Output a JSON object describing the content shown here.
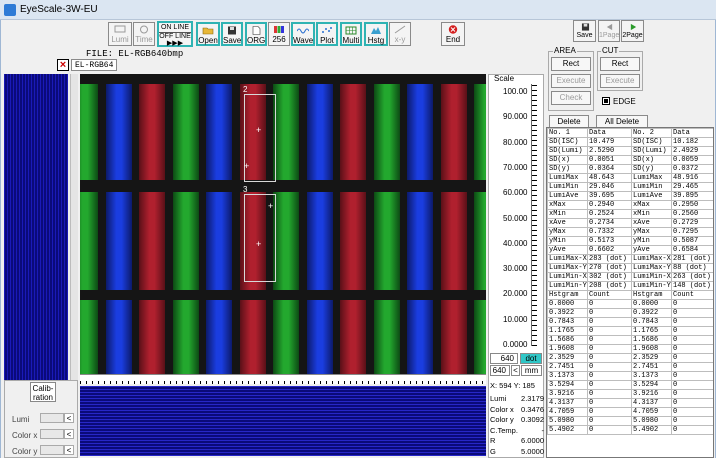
{
  "window": {
    "title": "EyeScale-3W-EU"
  },
  "toolbar": {
    "lumi": "Lumi",
    "time": "Time",
    "online": "ON LINE",
    "offline": "OFF LINE",
    "open": "Open",
    "save": "Save",
    "org": "ORG",
    "c256": "256",
    "wave": "Wave",
    "plot": "Plot",
    "multi": "Multi",
    "hstg": "Hstg",
    "xy": "x-y",
    "end": "End"
  },
  "nav": {
    "save": "Save",
    "page1": "1Page",
    "page2": "2Page"
  },
  "file": {
    "label": "FILE:",
    "name": "EL-RGB640bmp",
    "tab": "EL-RGB64"
  },
  "roi": [
    {
      "num": "2"
    },
    {
      "num": "3"
    }
  ],
  "calibration": {
    "title_1": "Calib-",
    "title_2": "ration",
    "labels": [
      "Lumi",
      "Color x",
      "Color y"
    ]
  },
  "scale": {
    "title": "Scale",
    "labels": [
      "100.00",
      "90.000",
      "80.000",
      "70.000",
      "60.000",
      "50.000",
      "40.000",
      "30.000",
      "20.000",
      "10.000",
      "0.0000"
    ],
    "width": "640",
    "height": "640",
    "unit_dot": "dot",
    "unit_mm": "mm",
    "arrow": "<"
  },
  "readout": {
    "xy": "X:  594 Y:  185",
    "rows": [
      {
        "k": "Lumi",
        "v": "2.3179"
      },
      {
        "k": "Color x",
        "v": "0.3476"
      },
      {
        "k": "Color y",
        "v": "0.3092"
      },
      {
        "k": "C.Temp.",
        "v": "-"
      },
      {
        "k": "R",
        "v": "6.0000"
      },
      {
        "k": "G",
        "v": "5.0000"
      }
    ]
  },
  "area": {
    "title": "AREA",
    "rect": "Rect",
    "execute": "Execute",
    "check": "Check"
  },
  "cut": {
    "title": "CUT",
    "rect": "Rect",
    "execute": "Execute"
  },
  "edge": "EDGE",
  "table_buttons": {
    "delete": "Delete",
    "all_delete": "All Delete"
  },
  "table": {
    "rows": [
      [
        "No. 1",
        "Data",
        "No. 2",
        "Data"
      ],
      [
        "SD(ISC)",
        "10.479",
        "SD(ISC)",
        "10.182"
      ],
      [
        "SD(Lumi)",
        "2.5290",
        "SD(Lumi)",
        "2.4929"
      ],
      [
        "SD(x)",
        "0.0051",
        "SD(x)",
        "0.0059"
      ],
      [
        "SD(y)",
        "0.0364",
        "SD(y)",
        "0.0372"
      ],
      [
        "LumiMax",
        "48.643",
        "LumiMax",
        "48.916"
      ],
      [
        "LumiMin",
        "29.046",
        "LumiMin",
        "29.465"
      ],
      [
        "LumiAve",
        "39.695",
        "LumiAve",
        "39.895"
      ],
      [
        "xMax",
        "0.2940",
        "xMax",
        "0.2950"
      ],
      [
        "xMin",
        "0.2524",
        "xMin",
        "0.2560"
      ],
      [
        "xAve",
        "0.2734",
        "xAve",
        "0.2729"
      ],
      [
        "yMax",
        "0.7332",
        "yMax",
        "0.7295"
      ],
      [
        "yMin",
        "0.5173",
        "yMin",
        "0.5087"
      ],
      [
        "yAve",
        "0.6602",
        "yAve",
        "0.6584"
      ],
      [
        "LumiMax-X",
        "283 (dot)",
        "LumiMax-X",
        "281 (dot)"
      ],
      [
        "LumiMax-Y",
        "270 (dot)",
        "LumiMax-Y",
        "88 (dot)"
      ],
      [
        "LumiMin-X",
        "302 (dot)",
        "LumiMin-X",
        "263 (dot)"
      ],
      [
        "LumiMin-Y",
        "208 (dot)",
        "LumiMin-Y",
        "148 (dot)"
      ],
      [
        "Hstgram",
        "Count",
        "Hstgram",
        "Count"
      ],
      [
        "0.0000",
        "0",
        "0.0000",
        "0"
      ],
      [
        "0.3922",
        "0",
        "0.3922",
        "0"
      ],
      [
        "0.7843",
        "0",
        "0.7843",
        "0"
      ],
      [
        "1.1765",
        "0",
        "1.1765",
        "0"
      ],
      [
        "1.5686",
        "0",
        "1.5686",
        "0"
      ],
      [
        "1.9608",
        "0",
        "1.9608",
        "0"
      ],
      [
        "2.3529",
        "0",
        "2.3529",
        "0"
      ],
      [
        "2.7451",
        "0",
        "2.7451",
        "0"
      ],
      [
        "3.1373",
        "0",
        "3.1373",
        "0"
      ],
      [
        "3.5294",
        "0",
        "3.5294",
        "0"
      ],
      [
        "3.9216",
        "0",
        "3.9216",
        "0"
      ],
      [
        "4.3137",
        "0",
        "4.3137",
        "0"
      ],
      [
        "4.7059",
        "0",
        "4.7059",
        "0"
      ],
      [
        "5.0980",
        "0",
        "5.0980",
        "0"
      ],
      [
        "5.4902",
        "0",
        "5.4902",
        "0"
      ]
    ]
  },
  "icons": {
    "app": "eye-icon",
    "end": "close-circle-icon"
  },
  "colors": {
    "accent": "#2fb3b3",
    "end": "#d42020",
    "field": "#0a0a7a"
  }
}
